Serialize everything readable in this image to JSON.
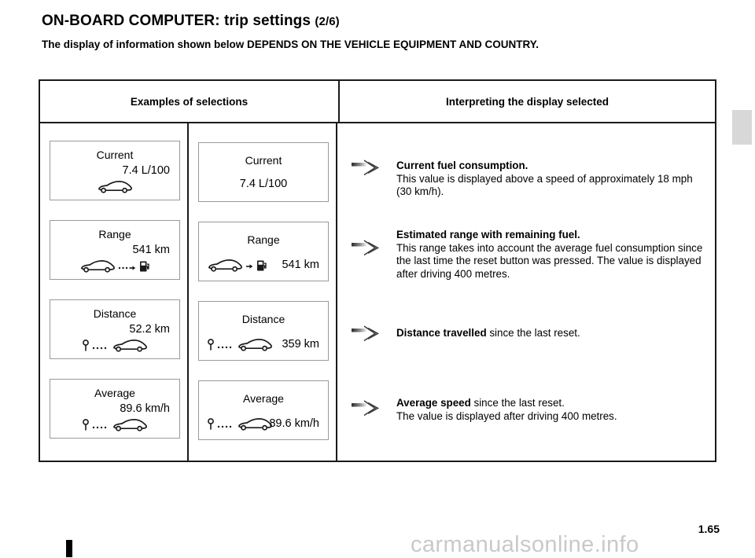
{
  "header": {
    "title_main": "ON-BOARD COMPUTER: trip settings",
    "title_fraction": "(2/6)",
    "subtitle": "The display of information shown below DEPENDS ON THE VEHICLE EQUIPMENT AND COUNTRY."
  },
  "table": {
    "columns": [
      {
        "label": "Examples of selections"
      },
      {
        "label": "Interpreting the display selected"
      }
    ],
    "rows": [
      {
        "key": "current",
        "example_a": {
          "label": "Current",
          "value": "7.4 L/100",
          "icons": [
            "car-icon"
          ]
        },
        "example_b": {
          "label": "Current",
          "value": "7.4 L/100",
          "icons": []
        },
        "interpretation": {
          "arrow": "arrow-right-icon",
          "heading": "Current fuel consumption.",
          "body": "This value is displayed above a speed of approximately 18 mph (30 km/h)."
        }
      },
      {
        "key": "range",
        "example_a": {
          "label": "Range",
          "value": "541 km",
          "icons": [
            "car-icon",
            "dotted-arrow-icon",
            "fuel-pump-icon"
          ]
        },
        "example_b": {
          "label": "Range",
          "value": "541 km",
          "icons": [
            "car-icon",
            "small-arrow-icon",
            "fuel-pump-icon"
          ]
        },
        "interpretation": {
          "arrow": "arrow-right-icon",
          "heading": "Estimated range with remaining fuel.",
          "body": "This range takes into account the average fuel consumption since the last time the reset button was pressed. The value is displayed after driving 400 metres."
        }
      },
      {
        "key": "distance",
        "example_a": {
          "label": "Distance",
          "value": "52.2 km",
          "icons": [
            "map-pin-icon",
            "dotted-line-icon",
            "car-icon"
          ]
        },
        "example_b": {
          "label": "Distance",
          "value": "359 km",
          "icons": [
            "map-pin-icon",
            "dotted-line-icon",
            "car-icon"
          ]
        },
        "interpretation": {
          "arrow": "arrow-right-icon",
          "heading": "Distance travelled",
          "body": " since the last reset."
        }
      },
      {
        "key": "average",
        "example_a": {
          "label": "Average",
          "value": "89.6 km/h",
          "icons": [
            "map-pin-icon",
            "dotted-line-icon",
            "car-icon"
          ]
        },
        "example_b": {
          "label": "Average",
          "value": "89.6 km/h",
          "icons": [
            "map-pin-icon",
            "dotted-line-icon",
            "car-icon"
          ]
        },
        "interpretation": {
          "arrow": "arrow-right-icon",
          "heading": "Average speed",
          "body": " since the last reset.\nThe value is displayed after driving 400 metres."
        }
      }
    ]
  },
  "footer": {
    "folio": "1.65",
    "watermark": "carmanualsonline.info"
  },
  "colors": {
    "border": "#1a1a1a",
    "panel_border": "#9a9a9a",
    "margin_tab": "#d8d8d8",
    "watermark": "#c9c9c9"
  }
}
